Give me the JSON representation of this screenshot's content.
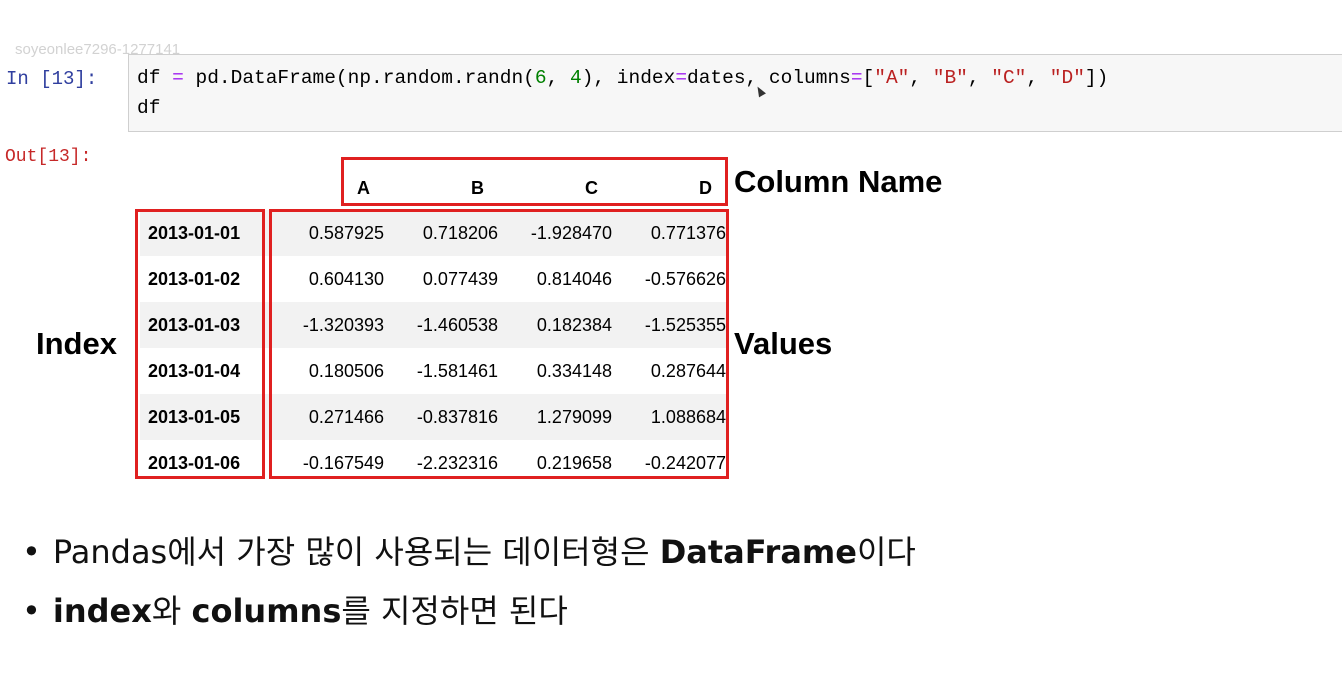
{
  "watermark": "soyeonlee7296-1277141",
  "input_cell": {
    "prompt": "In [13]:",
    "line1": {
      "t1": "df ",
      "op1": "=",
      "t2": " pd.DataFrame(np.random.randn(",
      "n1": "6",
      "t3": ", ",
      "n2": "4",
      "t4": "), index",
      "op2": "=",
      "t5": "dates, columns",
      "op3": "=",
      "t6": "[",
      "s1": "\"A\"",
      "t7": ", ",
      "s2": "\"B\"",
      "t8": ", ",
      "s3": "\"C\"",
      "t9": ", ",
      "s4": "\"D\"",
      "t10": "])"
    },
    "line2": "df"
  },
  "output_cell": {
    "prompt": "Out[13]:"
  },
  "dataframe": {
    "columns": [
      "A",
      "B",
      "C",
      "D"
    ],
    "rows": [
      {
        "index": "2013-01-01",
        "values": [
          "0.587925",
          "0.718206",
          "-1.928470",
          "0.771376"
        ]
      },
      {
        "index": "2013-01-02",
        "values": [
          "0.604130",
          "0.077439",
          "0.814046",
          "-0.576626"
        ]
      },
      {
        "index": "2013-01-03",
        "values": [
          "-1.320393",
          "-1.460538",
          "0.182384",
          "-1.525355"
        ]
      },
      {
        "index": "2013-01-04",
        "values": [
          "0.180506",
          "-1.581461",
          "0.334148",
          "0.287644"
        ]
      },
      {
        "index": "2013-01-05",
        "values": [
          "0.271466",
          "-0.837816",
          "1.279099",
          "1.088684"
        ]
      },
      {
        "index": "2013-01-06",
        "values": [
          "-0.167549",
          "-2.232316",
          "0.219658",
          "-0.242077"
        ]
      }
    ]
  },
  "annotations": {
    "column_name": "Column Name",
    "index": "Index",
    "values": "Values",
    "box_color": "#e02020"
  },
  "bullets": {
    "dot": "•",
    "b1_pre": "Pandas에서 가장 많이 사용되는 데이터형은 ",
    "b1_bold": "DataFrame",
    "b1_post": "이다",
    "b2_bold1": "index",
    "b2_mid": "와 ",
    "b2_bold2": "columns",
    "b2_post": "를 지정하면 된다"
  }
}
